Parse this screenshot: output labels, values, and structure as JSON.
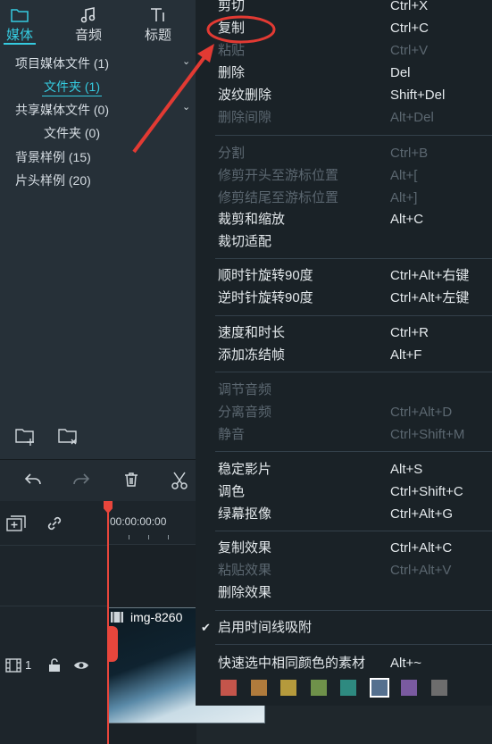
{
  "tabs": [
    {
      "label": "媒体",
      "icon": "folder-icon"
    },
    {
      "label": "音频",
      "icon": "music-note-icon"
    },
    {
      "label": "标题",
      "icon": "text-icon"
    }
  ],
  "media_tree": [
    {
      "label": "项目媒体文件 (1)"
    },
    {
      "label": "文件夹 (1)"
    },
    {
      "label": "共享媒体文件 (0)"
    },
    {
      "label": "文件夹 (0)"
    },
    {
      "label": "背景样例 (15)"
    },
    {
      "label": "片头样例 (20)"
    }
  ],
  "panel_icons": [
    "add-folder-icon",
    "remove-folder-icon"
  ],
  "toolbar_icons": [
    "undo-icon",
    "redo-icon",
    "delete-icon",
    "scissors-icon"
  ],
  "timeline": {
    "timecode": "00:00:00:00",
    "track_number": "1",
    "clip_name": "img-8260"
  },
  "menu": [
    {
      "label": "剪切",
      "shortcut": "Ctrl+X",
      "enabled": true
    },
    {
      "label": "复制",
      "shortcut": "Ctrl+C",
      "enabled": true
    },
    {
      "label": "粘贴",
      "shortcut": "Ctrl+V",
      "enabled": false
    },
    {
      "label": "删除",
      "shortcut": "Del",
      "enabled": true
    },
    {
      "label": "波纹删除",
      "shortcut": "Shift+Del",
      "enabled": true
    },
    {
      "label": "删除间隙",
      "shortcut": "Alt+Del",
      "enabled": false
    },
    {
      "label": "分割",
      "shortcut": "Ctrl+B",
      "enabled": false
    },
    {
      "label": "修剪开头至游标位置",
      "shortcut": "Alt+[",
      "enabled": false
    },
    {
      "label": "修剪结尾至游标位置",
      "shortcut": "Alt+]",
      "enabled": false
    },
    {
      "label": "裁剪和缩放",
      "shortcut": "Alt+C",
      "enabled": true
    },
    {
      "label": "裁切适配",
      "shortcut": "",
      "enabled": true
    },
    {
      "label": "顺时针旋转90度",
      "shortcut": "Ctrl+Alt+右键",
      "enabled": true
    },
    {
      "label": "逆时针旋转90度",
      "shortcut": "Ctrl+Alt+左键",
      "enabled": true
    },
    {
      "label": "速度和时长",
      "shortcut": "Ctrl+R",
      "enabled": true
    },
    {
      "label": "添加冻结帧",
      "shortcut": "Alt+F",
      "enabled": true
    },
    {
      "label": "调节音频",
      "shortcut": "",
      "enabled": false
    },
    {
      "label": "分离音频",
      "shortcut": "Ctrl+Alt+D",
      "enabled": false
    },
    {
      "label": "静音",
      "shortcut": "Ctrl+Shift+M",
      "enabled": false
    },
    {
      "label": "稳定影片",
      "shortcut": "Alt+S",
      "enabled": true
    },
    {
      "label": "调色",
      "shortcut": "Ctrl+Shift+C",
      "enabled": true
    },
    {
      "label": "绿幕抠像",
      "shortcut": "Ctrl+Alt+G",
      "enabled": true
    },
    {
      "label": "复制效果",
      "shortcut": "Ctrl+Alt+C",
      "enabled": true
    },
    {
      "label": "粘贴效果",
      "shortcut": "Ctrl+Alt+V",
      "enabled": false
    },
    {
      "label": "删除效果",
      "shortcut": "",
      "enabled": true
    },
    {
      "label": "启用时间线吸附",
      "shortcut": "",
      "enabled": true,
      "checked": true
    },
    {
      "label": "快速选中相同颜色的素材",
      "shortcut": "Alt+~",
      "enabled": true
    }
  ],
  "color_swatches": [
    "#c4554b",
    "#b07b3c",
    "#b59a3c",
    "#6f914a",
    "#2e8a80",
    "#55708f",
    "#7a5aa0",
    "#6d6d6d"
  ],
  "colors": {
    "accent": "#35cbe0",
    "annotation": "#e23a33",
    "playhead": "#e8463c"
  }
}
